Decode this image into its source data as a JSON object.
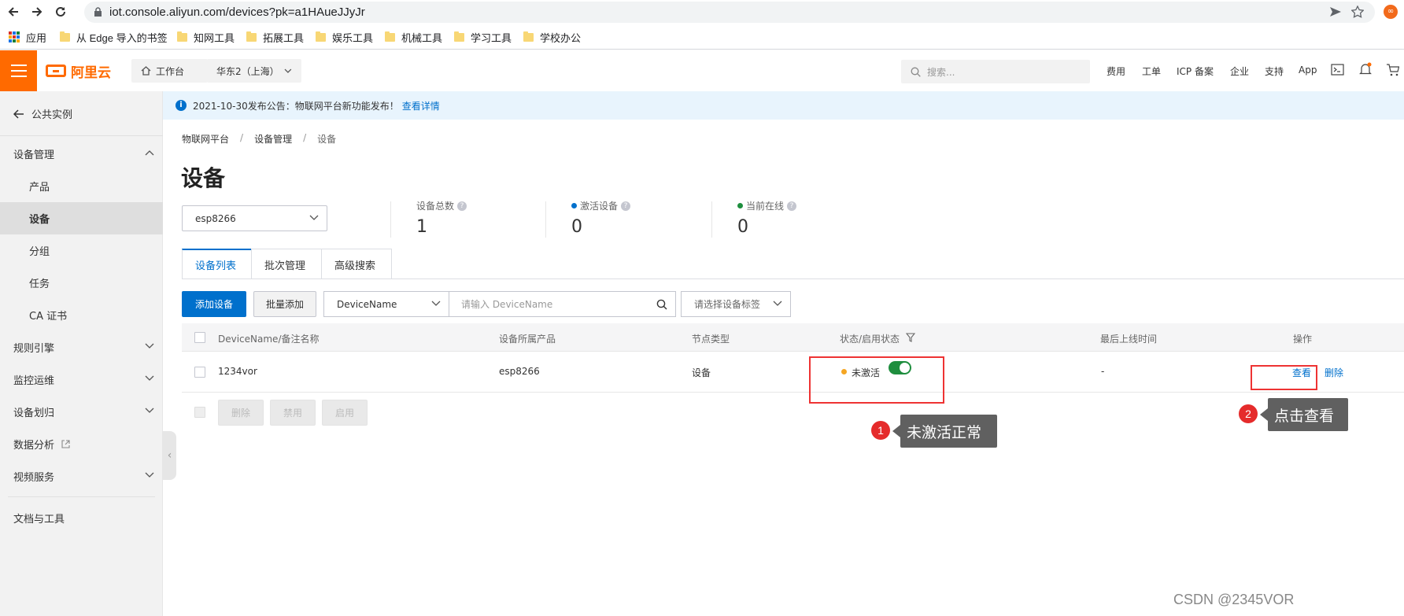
{
  "browser": {
    "url": "iot.console.aliyun.com/devices?pk=a1HAueJJyJr",
    "bookmarks": [
      {
        "label": "应用",
        "icon": "apps-grid-icon"
      },
      {
        "label": "从 Edge 导入的书签",
        "icon": "folder-icon"
      },
      {
        "label": "知网工具",
        "icon": "folder-icon"
      },
      {
        "label": "拓展工具",
        "icon": "folder-icon"
      },
      {
        "label": "娱乐工具",
        "icon": "folder-icon"
      },
      {
        "label": "机械工具",
        "icon": "folder-icon"
      },
      {
        "label": "学习工具",
        "icon": "folder-icon"
      },
      {
        "label": "学校办公",
        "icon": "folder-icon"
      }
    ]
  },
  "topbar": {
    "logo": "阿里云",
    "workbench": "工作台",
    "region": "华东2（上海）",
    "search_placeholder": "搜索...",
    "links": [
      "费用",
      "工单",
      "ICP 备案",
      "企业",
      "支持",
      "App"
    ],
    "accent_color": "#ff6a00"
  },
  "sidebar": {
    "back_label": "公共实例",
    "items": [
      {
        "label": "设备管理",
        "expanded": true
      },
      {
        "label": "产品"
      },
      {
        "label": "设备",
        "active": true
      },
      {
        "label": "分组"
      },
      {
        "label": "任务"
      },
      {
        "label": "CA 证书"
      },
      {
        "label": "规则引擎"
      },
      {
        "label": "监控运维"
      },
      {
        "label": "设备划归"
      },
      {
        "label": "数据分析"
      },
      {
        "label": "视频服务"
      },
      {
        "label": "文档与工具"
      }
    ]
  },
  "announcement": {
    "text": "2021-10-30发布公告：物联网平台新功能发布！",
    "link": "查看详情"
  },
  "breadcrumb": [
    "物联网平台",
    "设备管理",
    "设备"
  ],
  "page_title": "设备",
  "product_select": "esp8266",
  "stats": [
    {
      "label": "设备总数",
      "value": "1"
    },
    {
      "label": "激活设备",
      "value": "0",
      "dot_color": "#0070cc"
    },
    {
      "label": "当前在线",
      "value": "0",
      "dot_color": "#1e8e3e"
    }
  ],
  "tabs": [
    "设备列表",
    "批次管理",
    "高级搜索"
  ],
  "toolbar": {
    "add_device": "添加设备",
    "batch_add": "批量添加",
    "field_select": "DeviceName",
    "search_placeholder": "请输入 DeviceName",
    "tag_select": "请选择设备标签"
  },
  "table": {
    "headers": [
      "DeviceName/备注名称",
      "设备所属产品",
      "节点类型",
      "状态/启用状态",
      "最后上线时间",
      "操作"
    ],
    "rows": [
      {
        "name": "1234vor",
        "product": "esp8266",
        "node_type": "设备",
        "status": "未激活",
        "status_color": "#f5a623",
        "enabled": true,
        "last_online": "-",
        "actions": [
          "查看",
          "删除"
        ]
      }
    ],
    "bulk_actions": [
      "删除",
      "禁用",
      "启用"
    ]
  },
  "annotations": [
    {
      "num": "1",
      "text": "未激活正常"
    },
    {
      "num": "2",
      "text": "点击查看"
    }
  ],
  "watermark": "CSDN @2345VOR"
}
